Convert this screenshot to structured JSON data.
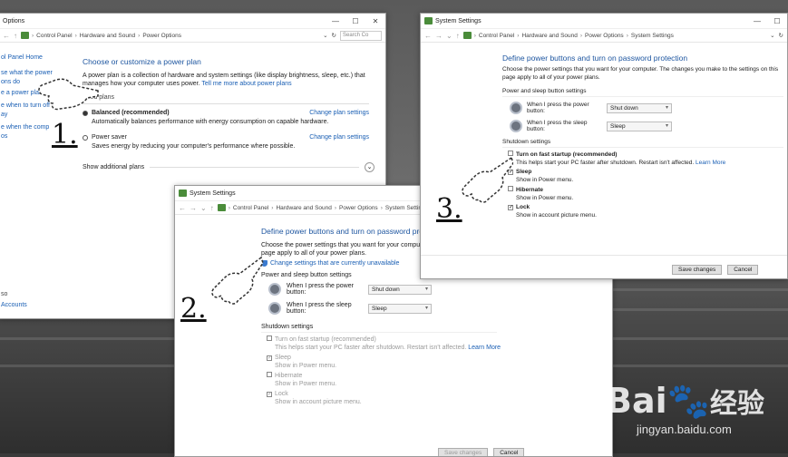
{
  "win1": {
    "title": "Options",
    "crumbs": [
      "Control Panel",
      "Hardware and Sound",
      "Power Options"
    ],
    "search": "Search Co",
    "sidebar": [
      "ol Panel Home",
      "se what the power",
      "ons do",
      "e a power plan",
      "e when to turn off",
      "ay",
      "e when the compute",
      "os"
    ],
    "sidebar_bottom": [
      "so",
      "Accounts"
    ],
    "heading": "Choose or customize a power plan",
    "intro": "A power plan is a collection of hardware and system settings (like display brightness, sleep, etc.) that",
    "intro2": "manages how your computer uses power.",
    "intro_link": "Tell me more about power plans",
    "section": "erred plans",
    "plans": [
      {
        "name": "Balanced (recommended)",
        "desc": "Automatically balances performance with energy consumption on capable hardware.",
        "link": "Change plan settings"
      },
      {
        "name": "Power saver",
        "desc": "Saves energy by reducing your computer's performance where possible.",
        "link": "Change plan settings"
      }
    ],
    "show_more": "Show additional plans"
  },
  "win2": {
    "title": "System Settings",
    "crumbs": [
      "Control Panel",
      "Hardware and Sound",
      "Power Options",
      "System Settings"
    ],
    "heading": "Define power buttons and turn on password prote",
    "desc1": "Choose the power settings that you want for your computer. The c",
    "desc2": "page apply to all of your power plans.",
    "change_link": "Change settings that are currently unavailable",
    "section1": "Power and sleep button settings",
    "power_label": "When I press the power button:",
    "power_value": "Shut down",
    "sleep_label": "When I press the sleep button:",
    "sleep_value": "Sleep",
    "section2": "Shutdown settings",
    "items": [
      {
        "label": "Turn on fast startup (recommended)",
        "desc": "This helps start your PC faster after shutdown. Restart isn't affected.",
        "link": "Learn More"
      },
      {
        "label": "Sleep",
        "desc": "Show in Power menu."
      },
      {
        "label": "Hibernate",
        "desc": "Show in Power menu."
      },
      {
        "label": "Lock",
        "desc": "Show in account picture menu."
      }
    ],
    "save": "Save changes",
    "cancel": "Cancel"
  },
  "win3": {
    "title": "System Settings",
    "crumbs": [
      "Control Panel",
      "Hardware and Sound",
      "Power Options",
      "System Settings"
    ],
    "heading": "Define power buttons and turn on password protection",
    "desc1": "Choose the power settings that you want for your computer. The changes you make to the settings on this",
    "desc2": "page apply to all of your power plans.",
    "section1": "Power and sleep button settings",
    "power_label": "When I press the power button:",
    "power_value": "Shut down",
    "sleep_label": "When I press the sleep button:",
    "sleep_value": "Sleep",
    "section2": "Shutdown settings",
    "items": [
      {
        "label": "Turn on fast startup (recommended)",
        "desc": "This helps start your PC faster after shutdown. Restart isn't affected.",
        "link": "Learn More",
        "checked": false
      },
      {
        "label": "Sleep",
        "desc": "Show in Power menu.",
        "checked": true
      },
      {
        "label": "Hibernate",
        "desc": "Show in Power menu.",
        "checked": false
      },
      {
        "label": "Lock",
        "desc": "Show in account picture menu.",
        "checked": true
      }
    ],
    "save": "Save changes",
    "cancel": "Cancel"
  },
  "steps": [
    "1.",
    "2.",
    "3."
  ],
  "watermark": {
    "brand": "Bai",
    "brand2": "经验",
    "url": "jingyan.baidu.com"
  }
}
